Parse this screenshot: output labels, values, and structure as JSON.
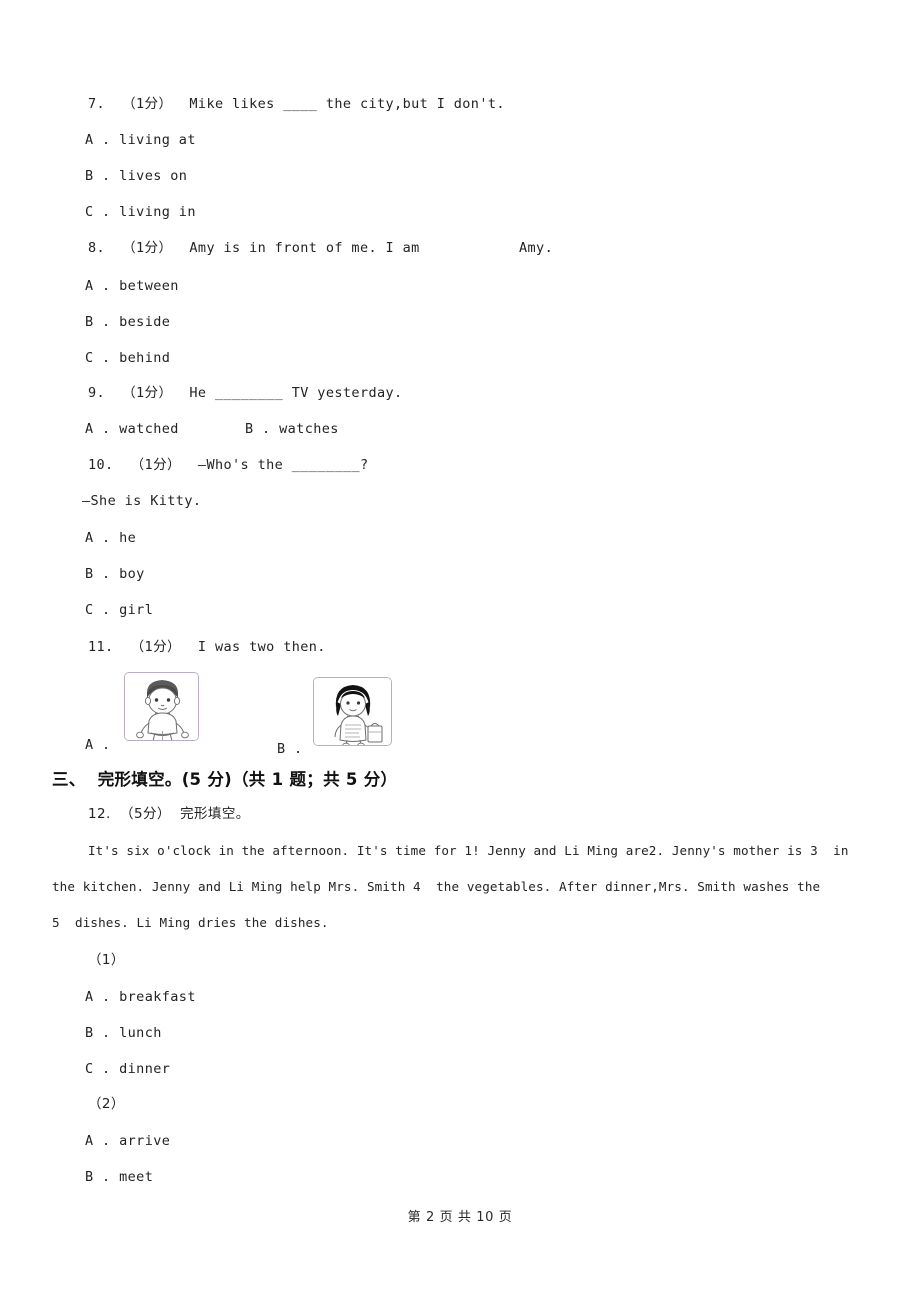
{
  "document": {
    "footer": "第 2 页 共 10 页"
  },
  "questions": [
    {
      "id": "q7",
      "stem": "7.  （1分）  Mike likes ____ the city,but I don't.",
      "options": [
        "A . living at",
        "B . lives on",
        "C . living in"
      ]
    },
    {
      "id": "q8",
      "stem_before": "8.  （1分）  Amy is in front of me. I am",
      "stem_after": "Amy.",
      "options": [
        "A . between",
        "B . beside",
        "C . behind"
      ]
    },
    {
      "id": "q9",
      "stem": "9.  （1分）  He ________ TV yesterday.",
      "option_a": "A . watched",
      "option_b": "B . watches"
    },
    {
      "id": "q10",
      "stem": "10.  （1分）  —Who's the ________?",
      "stem_line2": "—She is Kitty.",
      "options": [
        "A . he",
        "B . boy",
        "C . girl"
      ]
    },
    {
      "id": "q11",
      "stem": "11.  （1分）  I was two then.",
      "label_a": "A .",
      "label_b": "B .",
      "image_a_name": "child-sitting-cartoon",
      "image_b_name": "child-standing-with-bag-cartoon"
    }
  ],
  "section_three": {
    "heading": "三、  完形填空。(5 分)（共 1 题；共 5 分）",
    "question_header": "12.  （5分）  完形填空。",
    "passage_lines": [
      "It's six o'clock in the afternoon. It's time for 1! Jenny and Li Ming are2. Jenny's mother is 3  in",
      "the kitchen. Jenny and Li Ming help Mrs. Smith 4  the vegetables. After dinner,Mrs. Smith washes the",
      "5  dishes. Li Ming dries the dishes."
    ],
    "sub_questions": [
      {
        "label": "（1）",
        "options": [
          "A . breakfast",
          "B . lunch",
          "C . dinner"
        ]
      },
      {
        "label": "（2）",
        "options": [
          "A . arrive",
          "B . meet"
        ]
      }
    ]
  },
  "colors": {
    "text": "#232323",
    "thumb_border": "#b9aec4",
    "page_background": "#ffffff"
  }
}
